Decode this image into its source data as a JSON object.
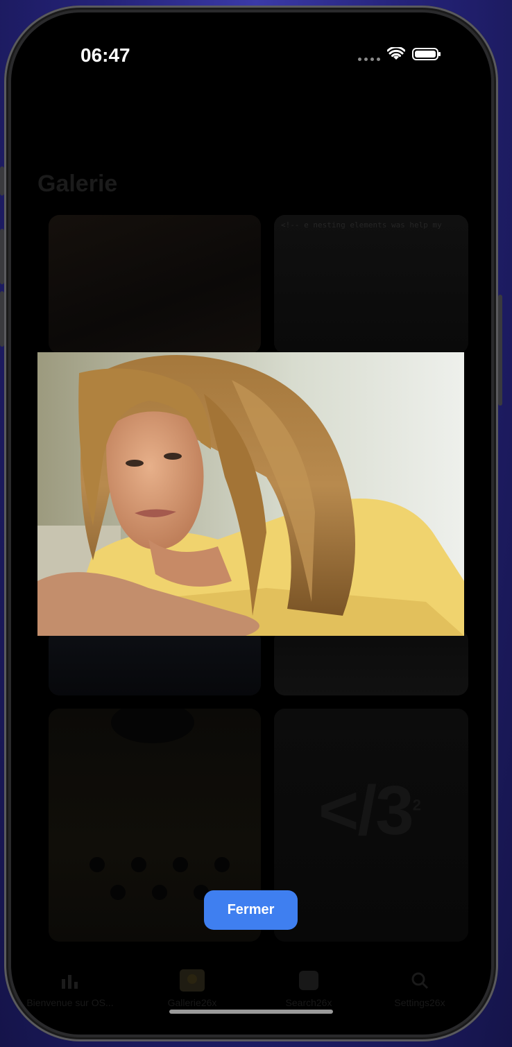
{
  "status_bar": {
    "time": "06:47"
  },
  "background_app": {
    "title": "Galerie",
    "code_snippet": "<!-- e nesting elements was help my",
    "big_code": "</3",
    "big_code_sup": "2"
  },
  "tab_bar": {
    "items": [
      {
        "label": "Bienvenue sur OS...",
        "icon": "chart-icon"
      },
      {
        "label": "Gallerie26x",
        "icon": "photo-icon"
      },
      {
        "label": "Search26x",
        "icon": "search-icon"
      },
      {
        "label": "Settings26x",
        "icon": "gear-icon"
      }
    ]
  },
  "overlay": {
    "close_label": "Fermer",
    "photo_alt": "Portrait photo of a young woman with long light-brown hair in a yellow t-shirt"
  },
  "colors": {
    "accent": "#3f7ff0",
    "background": "#000000"
  }
}
